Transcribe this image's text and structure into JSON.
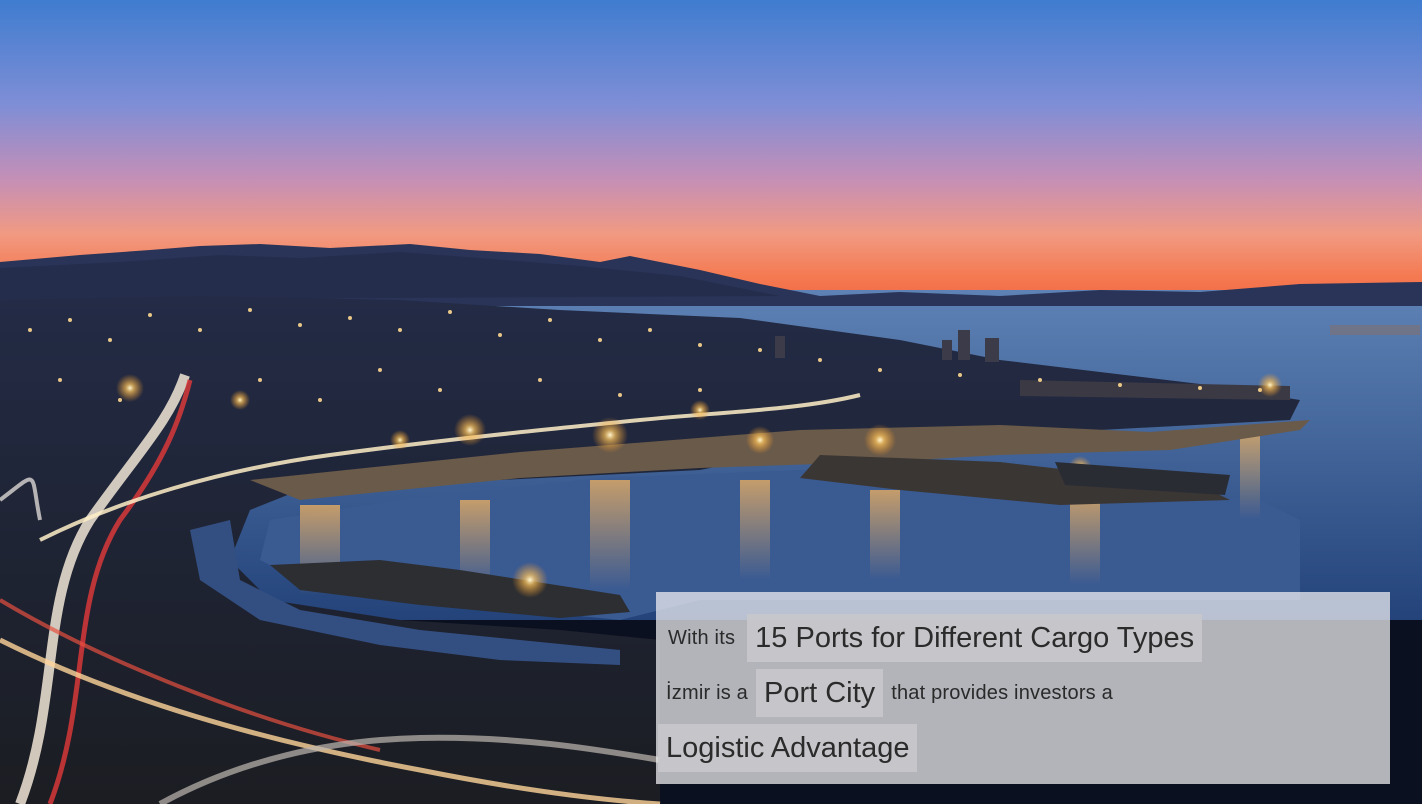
{
  "caption": {
    "line1_prefix": "With its",
    "line1_highlight": "15 Ports for Different Cargo Types",
    "line2_prefix": "İzmir is a",
    "line2_highlight": "Port City",
    "line2_suffix": "that provides investors a",
    "line3_highlight": "Logistic Advantage"
  }
}
